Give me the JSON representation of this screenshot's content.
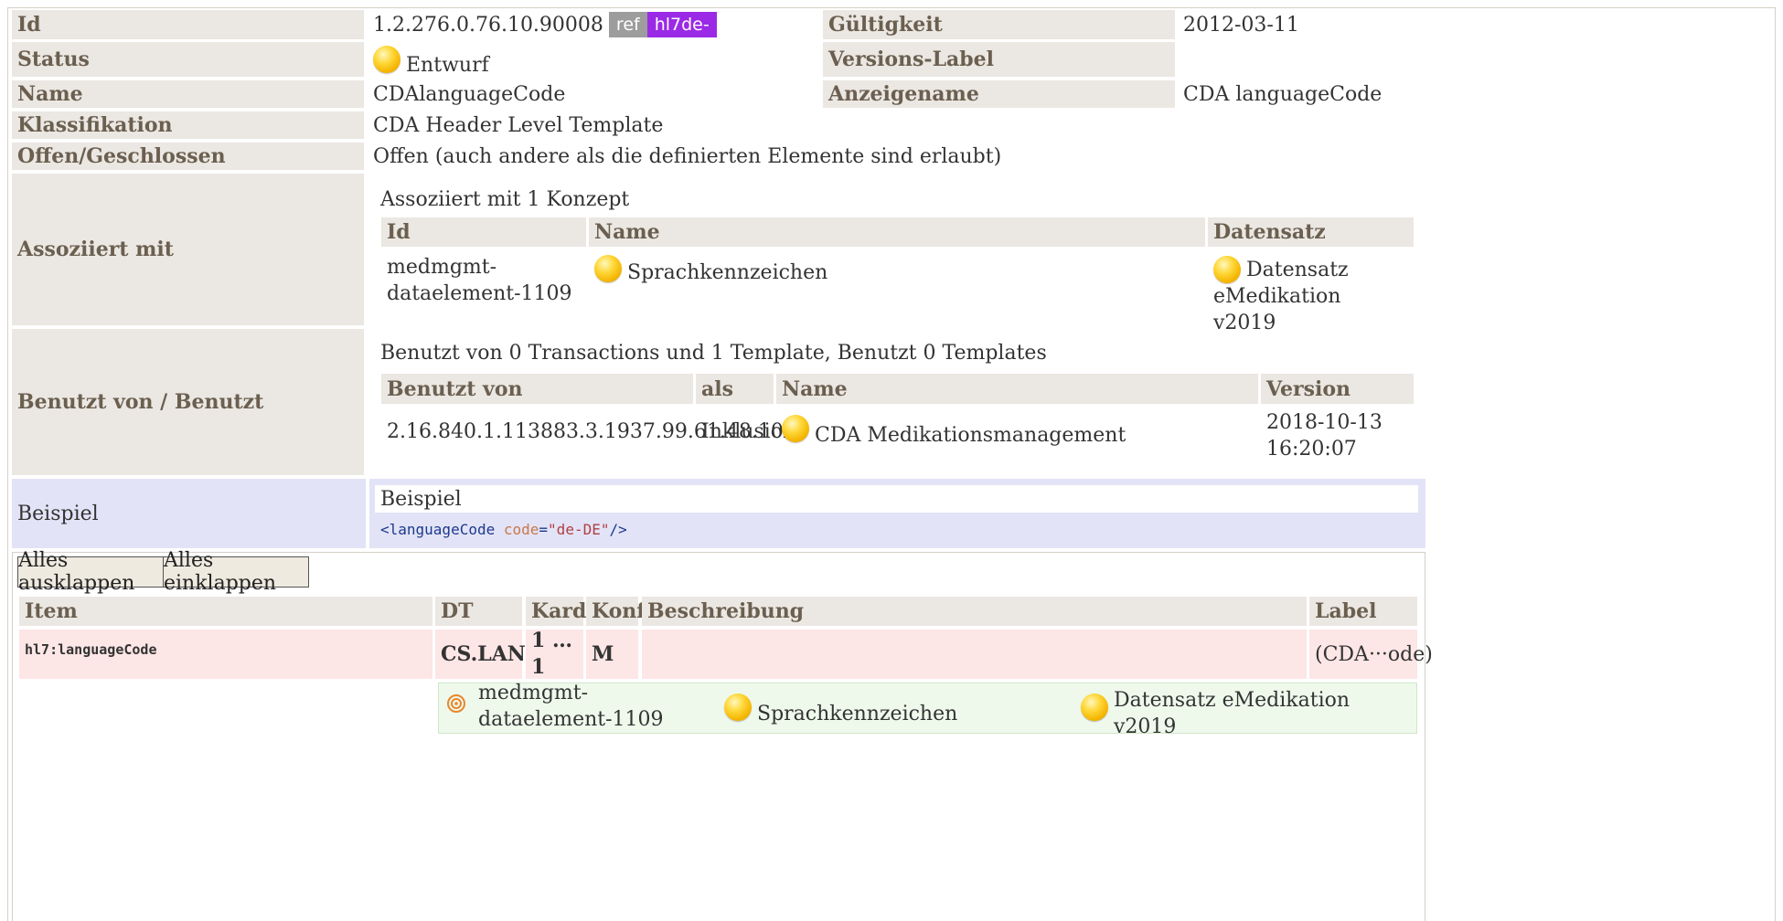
{
  "template": {
    "id_label": "Id",
    "id_value": "1.2.276.0.76.10.90008",
    "badge_ref": "ref",
    "badge_hl7": "hl7de-",
    "validity_label": "Gültigkeit",
    "validity_value": "2012-03-11",
    "status_label": "Status",
    "status_value": "Entwurf",
    "version_label": "Versions-Label",
    "version_value": "",
    "name_label": "Name",
    "name_value": "CDAlanguageCode",
    "display_label": "Anzeigename",
    "display_value": "CDA languageCode",
    "class_label": "Klassifikation",
    "class_value": "CDA Header Level Template",
    "open_label": "Offen/Geschlossen",
    "open_value": "Offen (auch andere als die definierten Elemente sind erlaubt)"
  },
  "associated": {
    "label": "Assoziiert mit",
    "summary": "Assoziiert mit 1 Konzept",
    "headers": [
      "Id",
      "Name",
      "Datensatz"
    ],
    "rows": [
      {
        "id_line1": "medmgmt-",
        "id_line2": "dataelement-1109",
        "name": "Sprachkennzeichen",
        "dataset_line1": "Datensatz",
        "dataset_line2": "eMedikation v2019"
      }
    ]
  },
  "usage": {
    "label": "Benutzt von / Benutzt",
    "summary": "Benutzt von 0 Transactions und 1 Template, Benutzt 0 Templates",
    "headers": [
      "Benutzt von",
      "als",
      "Name",
      "Version"
    ],
    "rows": [
      {
        "by": "2.16.840.1.113883.3.1937.99.61.48.10.1",
        "as": "Inklusion",
        "name": "CDA Medikationsmanagement",
        "version_line1": "2018-10-13",
        "version_line2": "16:20:07"
      }
    ]
  },
  "example": {
    "label": "Beispiel",
    "title": "Beispiel",
    "code_open": "<languageCode",
    "code_attr": "code",
    "code_eq": "=",
    "code_value": "\"de-DE\"",
    "code_close": "/>"
  },
  "toolbar": {
    "expand_all": "Alles ausklappen",
    "collapse_all": "Alles einklappen"
  },
  "items_table": {
    "headers": [
      "Item",
      "DT",
      "Kard",
      "Konf",
      "Beschreibung",
      "Label"
    ],
    "rows": [
      {
        "item": "hl7:languageCode",
        "dt": "CS.LANG",
        "card": "1 … 1",
        "conf": "M",
        "desc": "",
        "label": "(CDA···ode)"
      }
    ],
    "concept": {
      "id": "medmgmt-dataelement-1109",
      "name": "Sprachkennzeichen",
      "dataset": "Datensatz eMedikation v2019"
    }
  },
  "colors": {
    "label_bg": "#ebe7e2",
    "label_text": "#6b5f50",
    "example_bg": "#e3e3f7",
    "row_pink": "#fde6e6",
    "concept_green": "#eef9ec",
    "badge_purple": "#9b2ae6"
  }
}
